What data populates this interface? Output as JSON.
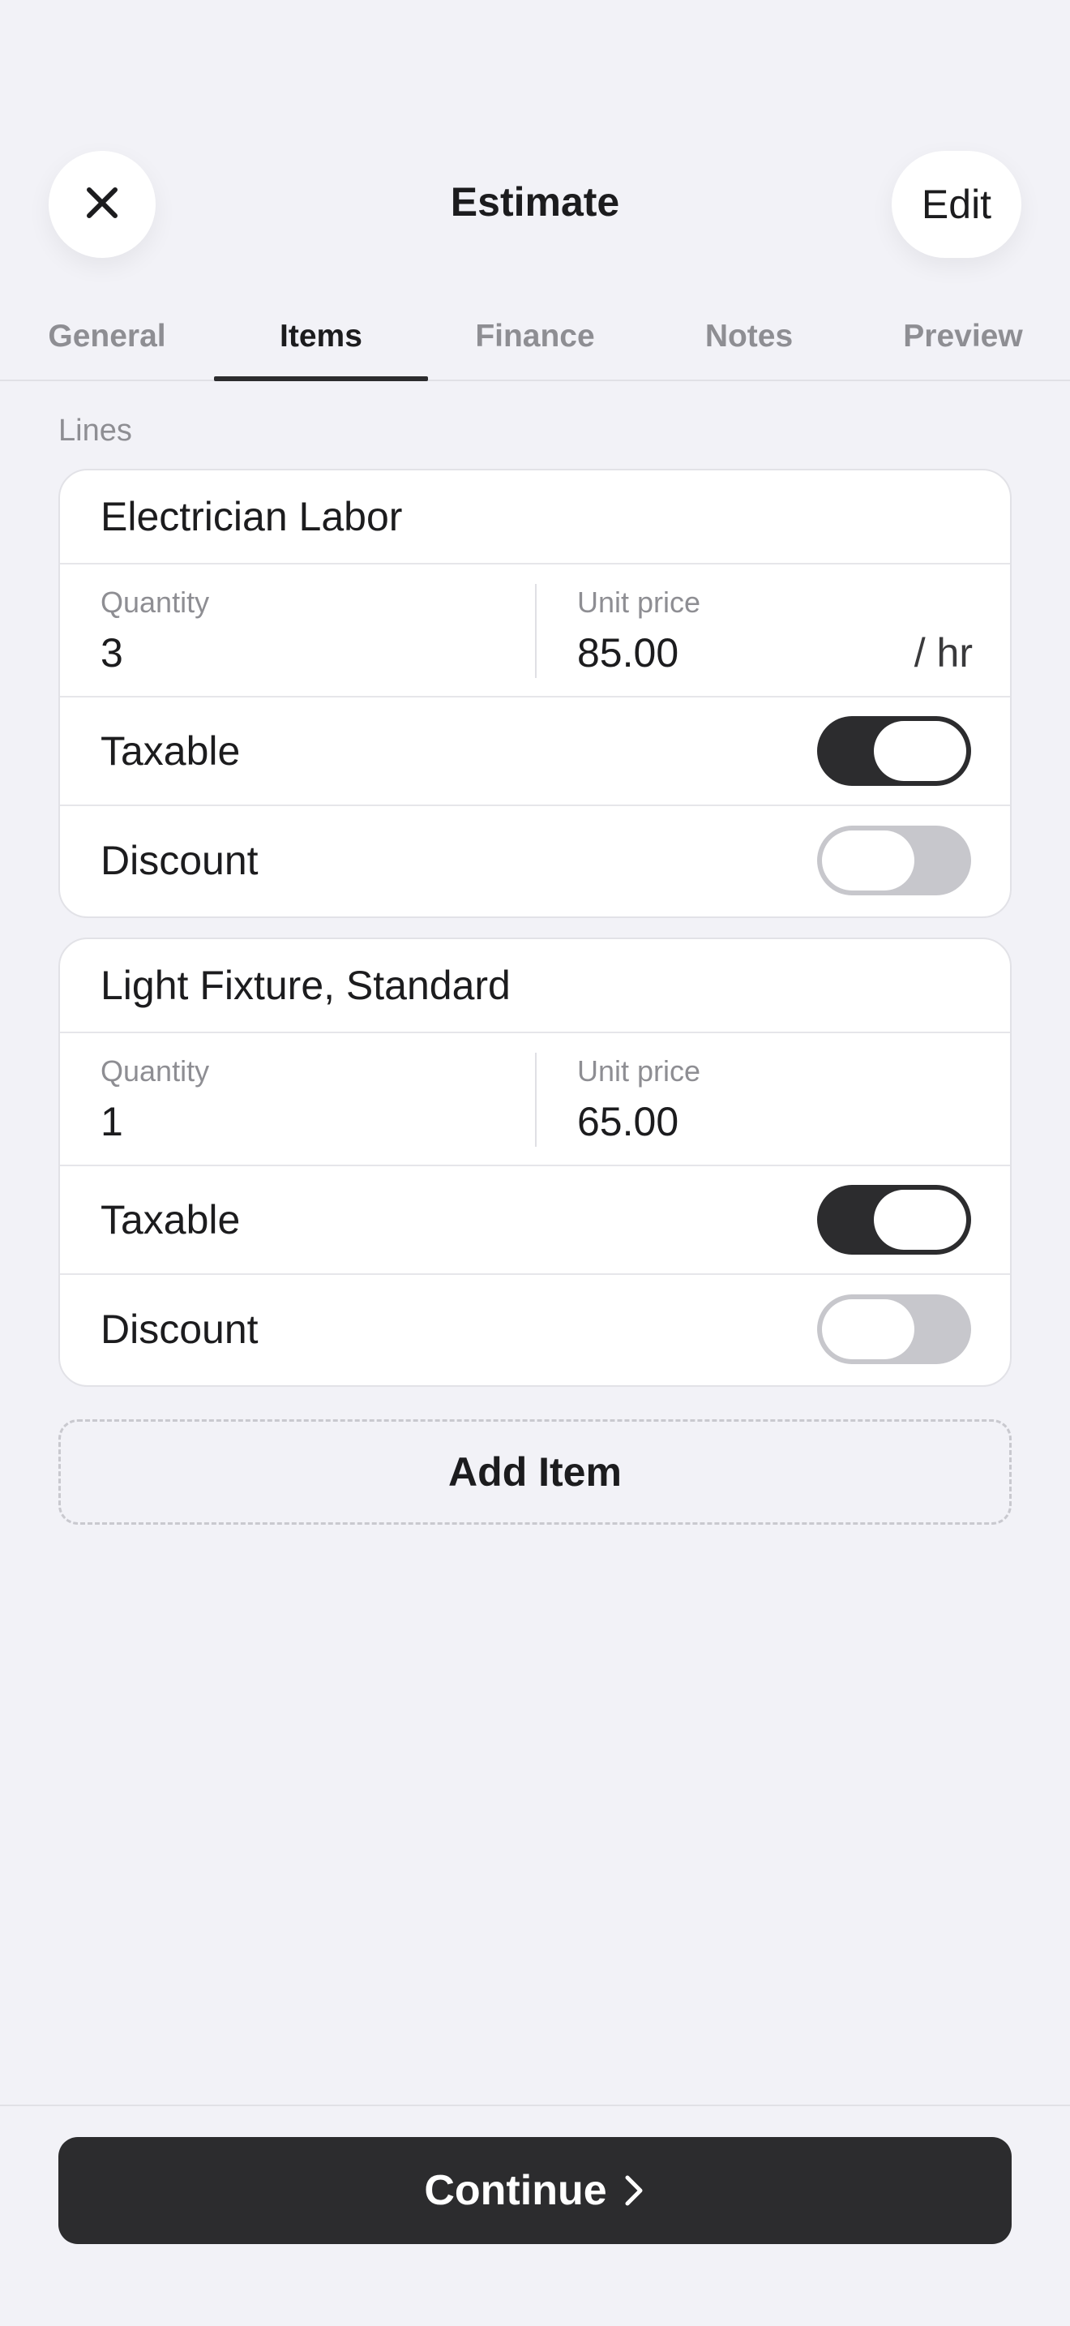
{
  "header": {
    "title": "Estimate",
    "close_icon": "close-icon",
    "edit_label": "Edit"
  },
  "tabs": [
    {
      "label": "General",
      "active": false
    },
    {
      "label": "Items",
      "active": true
    },
    {
      "label": "Finance",
      "active": false
    },
    {
      "label": "Notes",
      "active": false
    },
    {
      "label": "Preview",
      "active": false
    }
  ],
  "section_label": "Lines",
  "items": [
    {
      "name": "Electrician Labor",
      "quantity_label": "Quantity",
      "quantity": "3",
      "unit_price_label": "Unit price",
      "unit_price": "85.00",
      "unit": "/ hr",
      "taxable_label": "Taxable",
      "taxable": true,
      "discount_label": "Discount",
      "discount": false
    },
    {
      "name": "Light Fixture, Standard",
      "quantity_label": "Quantity",
      "quantity": "1",
      "unit_price_label": "Unit price",
      "unit_price": "65.00",
      "unit": "",
      "taxable_label": "Taxable",
      "taxable": true,
      "discount_label": "Discount",
      "discount": false
    }
  ],
  "add_item_label": "Add Item",
  "footer": {
    "continue_label": "Continue",
    "continue_icon": "chevron-right-icon"
  },
  "colors": {
    "background": "#f2f2f7",
    "accent": "#2c2c2e",
    "toggle_off": "#c7c7cc",
    "secondary_text": "#8e8e93"
  }
}
